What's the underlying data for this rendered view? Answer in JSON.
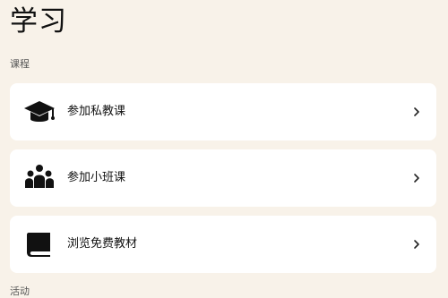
{
  "header": {
    "title": "学习"
  },
  "sections": {
    "courses": {
      "label": "课程"
    },
    "activities": {
      "label": "活动"
    }
  },
  "courses": [
    {
      "label": "参加私教课",
      "icon": "graduation-cap-icon"
    },
    {
      "label": "参加小班课",
      "icon": "group-icon"
    },
    {
      "label": "浏览免费教材",
      "icon": "book-icon"
    }
  ],
  "colors": {
    "background": "#f8f2e9",
    "card": "#ffffff",
    "text": "#111111"
  }
}
